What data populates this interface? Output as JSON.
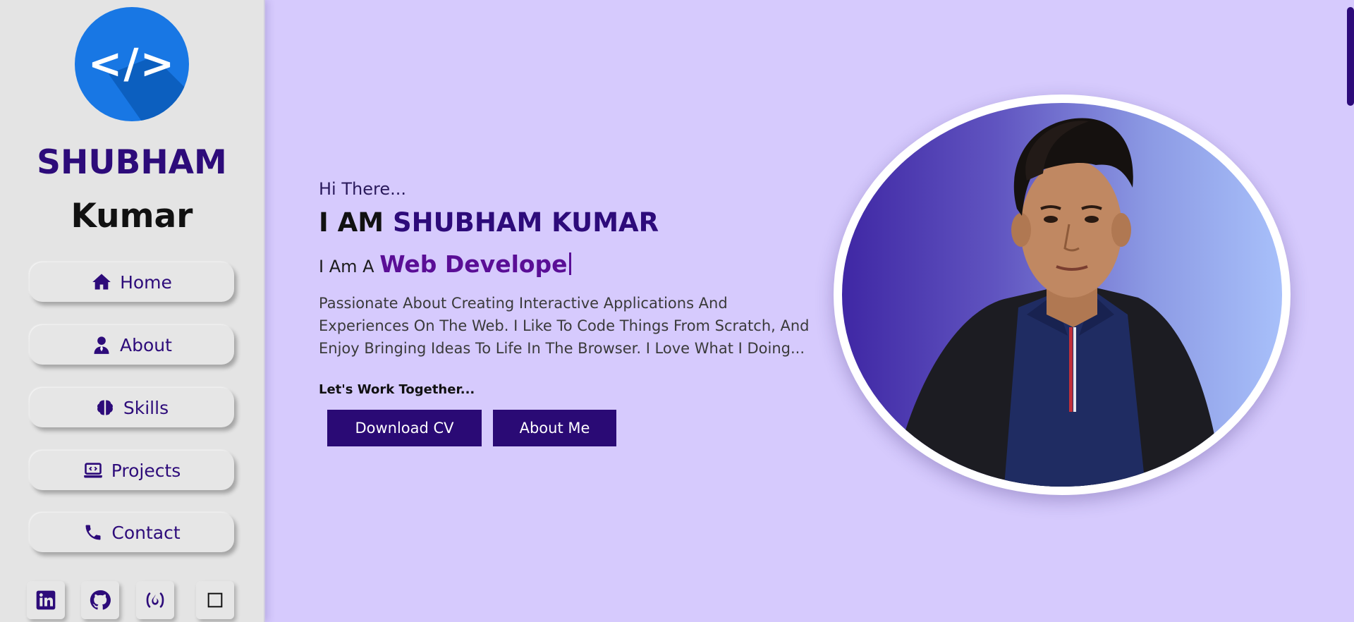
{
  "sidebar": {
    "logo_icon": "code-brackets-icon",
    "logo_text": "</>",
    "name_first": "SHUBHAM",
    "name_last": "Kumar",
    "nav": [
      {
        "label": "Home",
        "icon": "home-icon"
      },
      {
        "label": "About",
        "icon": "user-icon"
      },
      {
        "label": "Skills",
        "icon": "brain-icon"
      },
      {
        "label": "Projects",
        "icon": "laptop-code-icon"
      },
      {
        "label": "Contact",
        "icon": "phone-icon"
      }
    ],
    "social": [
      {
        "icon": "linkedin-icon"
      },
      {
        "icon": "github-icon"
      },
      {
        "icon": "freecodecamp-icon"
      },
      {
        "icon": "square-icon"
      }
    ]
  },
  "hero": {
    "greeting": "Hi There...",
    "headline_prefix": "I AM ",
    "headline_name": "SHUBHAM KUMAR",
    "role_prefix": "I Am A ",
    "role_typed": "Web Develope",
    "description": "Passionate About Creating Interactive Applications And Experiences On The Web. I Like To Code Things From Scratch, And Enjoy Bringing Ideas To Life In The Browser. I Love What I Doing...",
    "cta_heading": "Let's Work Together...",
    "download_label": "Download CV",
    "about_label": "About Me",
    "photo": "profile-photo"
  },
  "colors": {
    "primary": "#2d0b7a",
    "background": "#d6cafd",
    "sidebar": "#e4e4e4",
    "logo": "#1877e4"
  }
}
